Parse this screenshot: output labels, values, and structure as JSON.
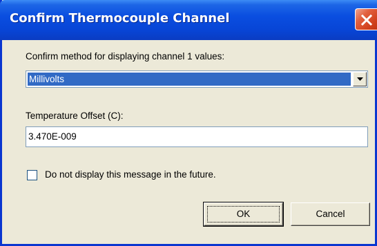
{
  "window": {
    "title": "Confirm Thermocouple Channel"
  },
  "method": {
    "label": "Confirm method for displaying channel 1 values:",
    "selected": "Millivolts"
  },
  "offset": {
    "label": "Temperature Offset (C):",
    "value": "3.470E-009"
  },
  "checkbox": {
    "label": "Do not display this message in the future.",
    "checked": false
  },
  "buttons": {
    "ok": "OK",
    "cancel": "Cancel"
  },
  "colors": {
    "titlebar": "#0a4ee0",
    "dialog_bg": "#ece9d8",
    "selection": "#316ac5",
    "close": "#d34420"
  },
  "icons": {
    "close": "close-icon",
    "dropdown": "chevron-down-icon"
  }
}
